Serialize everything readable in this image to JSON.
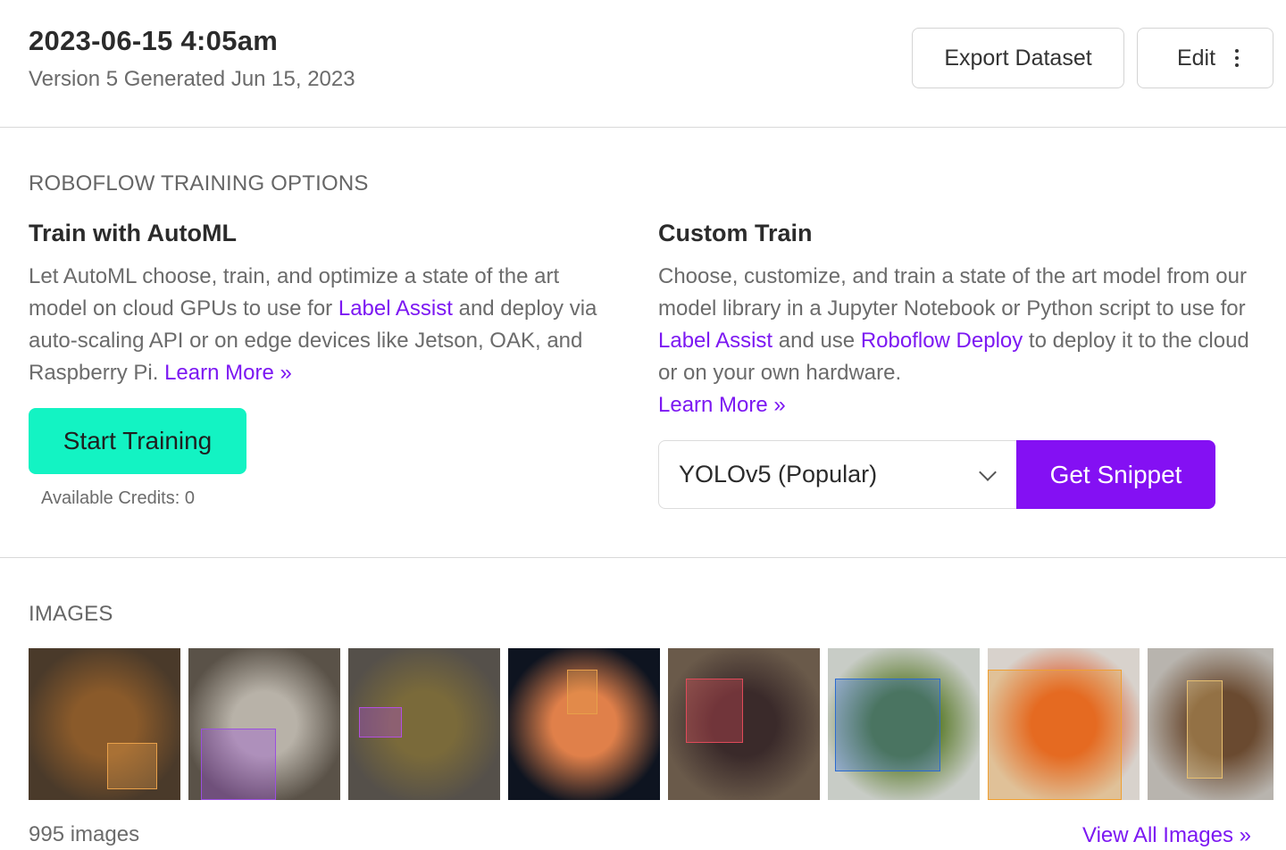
{
  "header": {
    "title": "2023-06-15 4:05am",
    "subtitle": "Version 5 Generated Jun 15, 2023",
    "export_label": "Export Dataset",
    "edit_label": "Edit",
    "menu_icon": "kebab-icon"
  },
  "training": {
    "section_label": "ROBOFLOW TRAINING OPTIONS",
    "automl": {
      "title": "Train with AutoML",
      "text_1": "Let AutoML choose, train, and optimize a state of the art model on cloud GPUs to use for ",
      "link_label_assist": "Label Assist",
      "text_2": " and deploy via auto-scaling API or on edge devices like Jetson, OAK, and Raspberry Pi. ",
      "learn_more": "Learn More »",
      "start_button": "Start Training",
      "credits": "Available Credits: 0"
    },
    "custom": {
      "title": "Custom Train",
      "text_1": "Choose, customize, and train a state of the art model from our model library in a Jupyter Notebook or Python script to use for ",
      "link_label_assist": "Label Assist",
      "text_2": " and use ",
      "link_deploy": "Roboflow Deploy",
      "text_3": " to deploy it to the cloud or on your own hardware.",
      "learn_more": "Learn More »",
      "model_select": "YOLOv5 (Popular)",
      "snippet_button": "Get Snippet"
    }
  },
  "images": {
    "section_label": "IMAGES",
    "count": "995 images",
    "view_all": "View All Images »",
    "thumbnails": [
      {
        "name": "thumb-croquettes",
        "bg": "#4a3a2a",
        "accent": "#8a5a2a",
        "box": "#e8a04a"
      },
      {
        "name": "thumb-rice-dishes",
        "bg": "#5a5248",
        "accent": "#b8b2a8",
        "box": "#9b4fe0"
      },
      {
        "name": "thumb-tray-meal",
        "bg": "#55504a",
        "accent": "#7a6a3a",
        "box": "#b44fe0"
      },
      {
        "name": "thumb-pizza",
        "bg": "#0e1420",
        "accent": "#e0804a",
        "box": "#e8a04a"
      },
      {
        "name": "thumb-sausage-board",
        "bg": "#6a5a4a",
        "accent": "#3a2a2a",
        "box": "#e04a5a"
      },
      {
        "name": "thumb-green-beans",
        "bg": "#c8ccc6",
        "accent": "#5a7a2a",
        "box": "#2a6ad0"
      },
      {
        "name": "thumb-tteokbokki",
        "bg": "#d8d2cc",
        "accent": "#e0501a",
        "box": "#f0a030"
      },
      {
        "name": "thumb-beef-stirfry",
        "bg": "#b8b4ae",
        "accent": "#6a4a30",
        "box": "#e8c070"
      }
    ]
  }
}
